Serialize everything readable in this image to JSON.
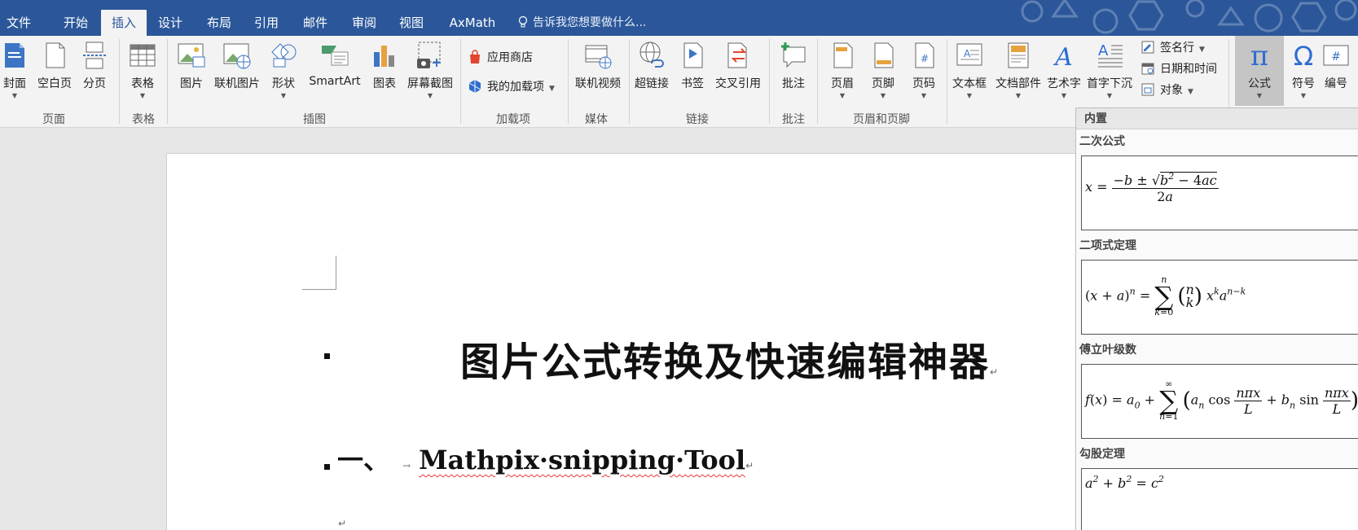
{
  "tabs": [
    {
      "label": "文件",
      "active": false
    },
    {
      "label": "开始",
      "active": false
    },
    {
      "label": "插入",
      "active": true
    },
    {
      "label": "设计",
      "active": false
    },
    {
      "label": "布局",
      "active": false
    },
    {
      "label": "引用",
      "active": false
    },
    {
      "label": "邮件",
      "active": false
    },
    {
      "label": "审阅",
      "active": false
    },
    {
      "label": "视图",
      "active": false
    },
    {
      "label": "AxMath",
      "active": false
    }
  ],
  "tellme": "告诉我您想要做什么...",
  "ribbon": {
    "pages": {
      "cover": "封面",
      "blank": "空白页",
      "break": "分页",
      "group": "页面"
    },
    "tables": {
      "table": "表格",
      "group": "表格"
    },
    "illustrations": {
      "picture": "图片",
      "online_picture": "联机图片",
      "shapes": "形状",
      "smartart": "SmartArt",
      "chart": "图表",
      "screenshot": "屏幕截图",
      "group": "插图"
    },
    "addins": {
      "store": "应用商店",
      "my_addins": "我的加载项",
      "group": "加载项"
    },
    "media": {
      "online_video": "联机视频",
      "group": "媒体"
    },
    "links": {
      "hyperlink": "超链接",
      "bookmark": "书签",
      "crossref": "交叉引用",
      "group": "链接"
    },
    "comments": {
      "comment": "批注",
      "group": "批注"
    },
    "header_footer": {
      "header": "页眉",
      "footer": "页脚",
      "page_number": "页码",
      "group": "页眉和页脚"
    },
    "text": {
      "textbox": "文本框",
      "quick_parts": "文档部件",
      "wordart": "艺术字",
      "dropcap": "首字下沉",
      "signature": "签名行",
      "datetime": "日期和时间",
      "object": "对象"
    },
    "symbols": {
      "equation": "公式",
      "symbol": "符号",
      "numbering": "编号"
    }
  },
  "document": {
    "title": "图片公式转换及快速编辑神器",
    "heading_number": "一、",
    "heading_text": "Mathpix·snipping·Tool",
    "return_mark": "↵",
    "tab_mark": "→"
  },
  "equation_panel": {
    "header": "内置",
    "items": [
      {
        "title": "二次公式"
      },
      {
        "title": "二项式定理"
      },
      {
        "title": "傅立叶级数"
      },
      {
        "title": "勾股定理"
      }
    ]
  },
  "colors": {
    "brand": "#2b579a",
    "ribbon_bg": "#f3f3f3",
    "active_group_bg": "#c5c5c5",
    "spell_error": "#e53935"
  }
}
